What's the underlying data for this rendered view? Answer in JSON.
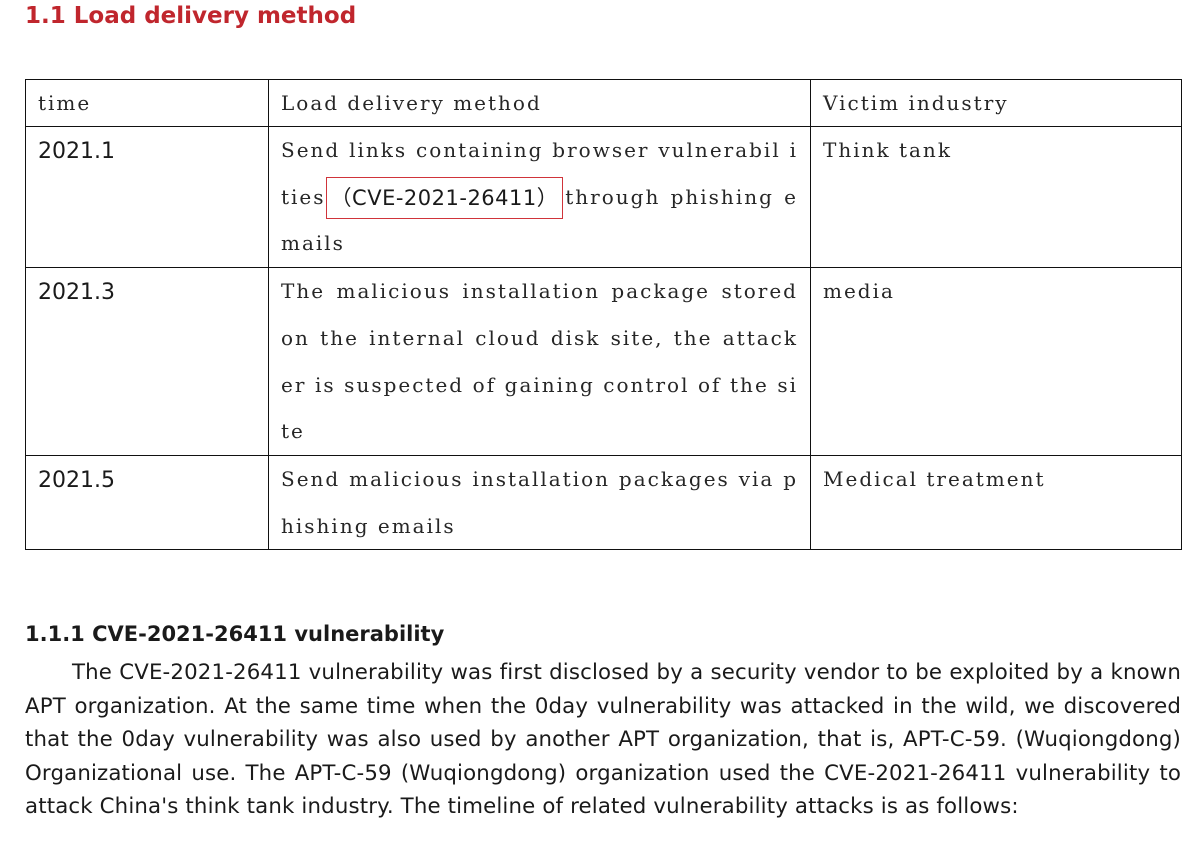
{
  "section": {
    "title": "1.1 Load delivery method"
  },
  "table": {
    "headers": [
      "time",
      "Load delivery method",
      "Victim industry"
    ],
    "rows": [
      {
        "time": "2021.1",
        "method_before": "Send links containing browser vulnerabil ities",
        "method_highlight": "（CVE-2021-26411）",
        "method_after": "through phishing emails",
        "victim": "Think tank"
      },
      {
        "time": "2021.3",
        "method": "The malicious installation package stored on the internal cloud disk site, the attacker is suspected of gaining control of the site",
        "victim": "media"
      },
      {
        "time": "2021.5",
        "method": "Send malicious installation packages via phishing emails",
        "victim": "Medical treatment"
      }
    ]
  },
  "subsection": {
    "title": "1.1.1 CVE-2021-26411 vulnerability",
    "paragraph": "The CVE-2021-26411 vulnerability was first disclosed by a security vendor to be exploited by a known APT organization. At the same time when the 0day vulnerability was attacked in the wild, we discovered that the 0day vulnerability was also used by another APT organization, that is, APT-C-59. (Wuqiongdong) Organizational use. The APT-C-59 (Wuqiongdong) organization used the CVE-2021-26411 vulnerability to attack China's think tank industry. The timeline of related vulnerability attacks is as follows:"
  },
  "colors": {
    "heading_red": "#c0262d",
    "highlight_border": "#d0343a",
    "text": "#1a1a1a"
  }
}
